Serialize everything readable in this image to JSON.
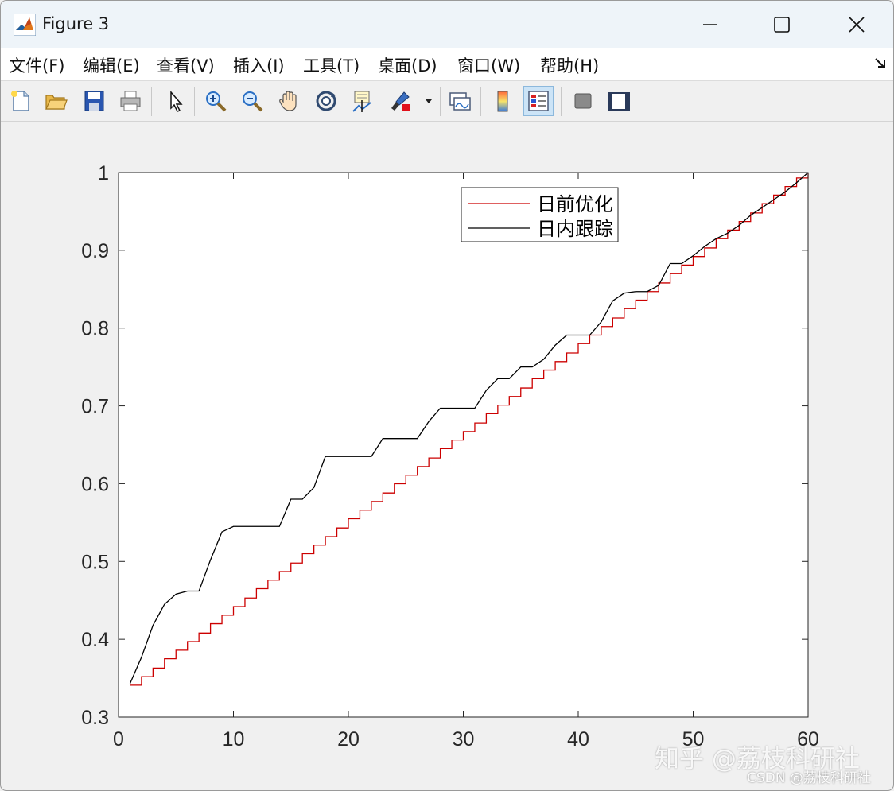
{
  "window": {
    "title": "Figure 3"
  },
  "menu": {
    "items": [
      "文件(F)",
      "编辑(E)",
      "查看(V)",
      "插入(I)",
      "工具(T)",
      "桌面(D)",
      "窗口(W)",
      "帮助(H)"
    ]
  },
  "toolbar": {
    "buttons": [
      {
        "icon": "new-figure-icon",
        "interactable": true
      },
      {
        "icon": "open-file-icon",
        "interactable": true
      },
      {
        "icon": "save-icon",
        "interactable": true
      },
      {
        "icon": "print-icon",
        "interactable": true
      },
      {
        "icon": "pointer-icon",
        "interactable": true
      },
      {
        "icon": "zoom-in-icon",
        "interactable": true
      },
      {
        "icon": "zoom-out-icon",
        "interactable": true
      },
      {
        "icon": "pan-hand-icon",
        "interactable": true
      },
      {
        "icon": "rotate-3d-icon",
        "interactable": true
      },
      {
        "icon": "data-cursor-icon",
        "interactable": true
      },
      {
        "icon": "brush-icon",
        "interactable": true
      },
      {
        "icon": "link-plot-icon",
        "interactable": true
      },
      {
        "icon": "colorbar-icon",
        "interactable": true
      },
      {
        "icon": "legend-icon",
        "interactable": true,
        "active": true
      },
      {
        "icon": "hide-plot-tools-icon",
        "interactable": true
      },
      {
        "icon": "show-plot-tools-icon",
        "interactable": true
      }
    ]
  },
  "colors": {
    "series_optimal": "#cc0000",
    "series_tracking": "#000000",
    "axes_bg": "#ffffff",
    "figure_bg": "#f0f0f0"
  },
  "chart_data": {
    "type": "line",
    "title": "",
    "xlabel": "",
    "ylabel": "",
    "xlim": [
      0,
      60
    ],
    "ylim": [
      0.3,
      1
    ],
    "xticks": [
      0,
      10,
      20,
      30,
      40,
      50,
      60
    ],
    "yticks": [
      0.3,
      0.4,
      0.5,
      0.6,
      0.7,
      0.8,
      0.9,
      1
    ],
    "grid": false,
    "legend_position": "top-right",
    "series": [
      {
        "name": "日前优化",
        "style": "stairs",
        "color": "#cc0000",
        "x": [
          1,
          2,
          3,
          4,
          5,
          6,
          7,
          8,
          9,
          10,
          11,
          12,
          13,
          14,
          15,
          16,
          17,
          18,
          19,
          20,
          21,
          22,
          23,
          24,
          25,
          26,
          27,
          28,
          29,
          30,
          31,
          32,
          33,
          34,
          35,
          36,
          37,
          38,
          39,
          40,
          41,
          42,
          43,
          44,
          45,
          46,
          47,
          48,
          49,
          50,
          51,
          52,
          53,
          54,
          55,
          56,
          57,
          58,
          59,
          60
        ],
        "y": [
          0.341,
          0.352,
          0.363,
          0.375,
          0.386,
          0.397,
          0.408,
          0.42,
          0.431,
          0.442,
          0.453,
          0.465,
          0.476,
          0.487,
          0.498,
          0.51,
          0.521,
          0.532,
          0.543,
          0.555,
          0.566,
          0.577,
          0.588,
          0.6,
          0.611,
          0.622,
          0.633,
          0.645,
          0.656,
          0.667,
          0.678,
          0.69,
          0.701,
          0.712,
          0.723,
          0.735,
          0.746,
          0.757,
          0.768,
          0.78,
          0.791,
          0.802,
          0.813,
          0.825,
          0.836,
          0.847,
          0.858,
          0.87,
          0.881,
          0.892,
          0.903,
          0.915,
          0.926,
          0.937,
          0.948,
          0.96,
          0.971,
          0.982,
          0.993,
          1.0
        ]
      },
      {
        "name": "日内跟踪",
        "style": "line",
        "color": "#000000",
        "x": [
          1,
          2,
          3,
          4,
          5,
          6,
          7,
          8,
          9,
          10,
          11,
          12,
          13,
          14,
          15,
          16,
          17,
          18,
          19,
          20,
          21,
          22,
          23,
          24,
          25,
          26,
          27,
          28,
          29,
          30,
          31,
          32,
          33,
          34,
          35,
          36,
          37,
          38,
          39,
          40,
          41,
          42,
          43,
          44,
          45,
          46,
          47,
          48,
          49,
          50,
          51,
          52,
          53,
          54,
          55,
          56,
          57,
          58,
          59,
          60
        ],
        "y": [
          0.343,
          0.377,
          0.418,
          0.445,
          0.458,
          0.462,
          0.462,
          0.502,
          0.538,
          0.545,
          0.545,
          0.545,
          0.545,
          0.545,
          0.58,
          0.58,
          0.595,
          0.635,
          0.635,
          0.635,
          0.635,
          0.635,
          0.658,
          0.658,
          0.658,
          0.658,
          0.68,
          0.697,
          0.697,
          0.697,
          0.697,
          0.72,
          0.735,
          0.735,
          0.75,
          0.75,
          0.76,
          0.778,
          0.791,
          0.791,
          0.791,
          0.808,
          0.835,
          0.845,
          0.847,
          0.847,
          0.855,
          0.883,
          0.883,
          0.893,
          0.905,
          0.915,
          0.922,
          0.932,
          0.945,
          0.955,
          0.965,
          0.975,
          0.987,
          1.0
        ]
      }
    ]
  },
  "watermark": {
    "main": "知乎 @荔枝科研社",
    "csdn": "CSDN @荔枝科研社"
  }
}
